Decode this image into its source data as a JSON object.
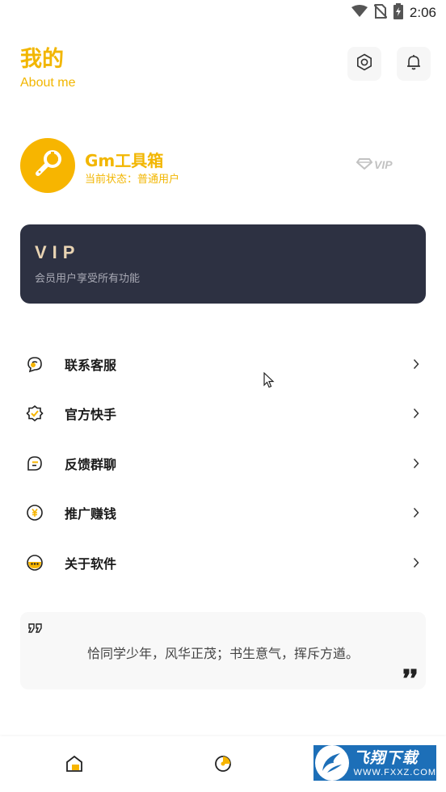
{
  "status_bar": {
    "time": "2:06",
    "icons": [
      "wifi-icon",
      "no-sim-icon",
      "battery-charging-icon"
    ]
  },
  "header": {
    "title": "我的",
    "subtitle": "About me",
    "buttons": [
      "settings-icon",
      "bell-icon"
    ]
  },
  "profile": {
    "name": "Gm工具箱",
    "status": "当前状态：普通用户",
    "vip_badge": "VIP",
    "avatar_icon": "wrench-icon"
  },
  "vip_card": {
    "title": "VIP",
    "description": "会员用户享受所有功能"
  },
  "menu": {
    "items": [
      {
        "label": "联系客服",
        "icon": "customer-service-icon"
      },
      {
        "label": "官方快手",
        "icon": "badge-check-icon"
      },
      {
        "label": "反馈群聊",
        "icon": "chat-bubble-icon"
      },
      {
        "label": "推广赚钱",
        "icon": "yen-coin-icon"
      },
      {
        "label": "关于软件",
        "icon": "info-dots-icon"
      }
    ]
  },
  "quote": {
    "text": "恰同学少年，风华正茂；书生意气，挥斥方遒。"
  },
  "bottom_nav": {
    "items": [
      "home-icon",
      "pie-chart-icon"
    ]
  },
  "watermark": {
    "main": "飞翔下载",
    "sub": "WWW.FXXZ.COM"
  },
  "colors": {
    "accent": "#f2b600",
    "vip_card": "#2d3142",
    "vip_title": "#e9d4b3"
  }
}
